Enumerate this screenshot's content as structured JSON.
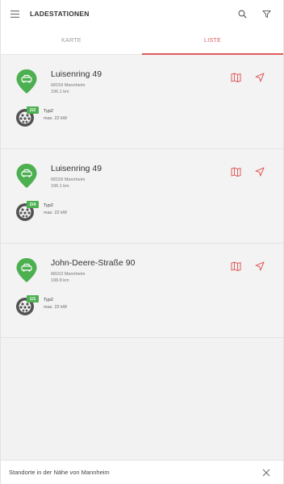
{
  "appbar": {
    "title": "LADESTATIONEN",
    "menu_icon": "hamburger-menu-icon",
    "search_icon": "search-icon",
    "filter_icon": "filter-icon"
  },
  "tabs": [
    {
      "label": "KARTE",
      "active": false
    },
    {
      "label": "LISTE",
      "active": true
    }
  ],
  "colors": {
    "accent": "#e05a5a",
    "pin": "#4caf50",
    "available": "#4caf50"
  },
  "stations": [
    {
      "name": "Luisenring 49",
      "address": "68159 Mannheim",
      "distance": "196.1 km",
      "availability": "2/2",
      "connector_type": "Typ2",
      "max_power": "max. 22 kW"
    },
    {
      "name": "Luisenring 49",
      "address": "68159 Mannheim",
      "distance": "196.1 km",
      "availability": "2/4",
      "connector_type": "Typ2",
      "max_power": "max. 22 kW"
    },
    {
      "name": "John-Deere-Straße 90",
      "address": "68163 Mannheim",
      "distance": "198.8 km",
      "availability": "1/1",
      "connector_type": "Typ2",
      "max_power": "max. 22 kW"
    }
  ],
  "bottombar": {
    "text": "Standorte in der Nähe von Mannheim"
  }
}
